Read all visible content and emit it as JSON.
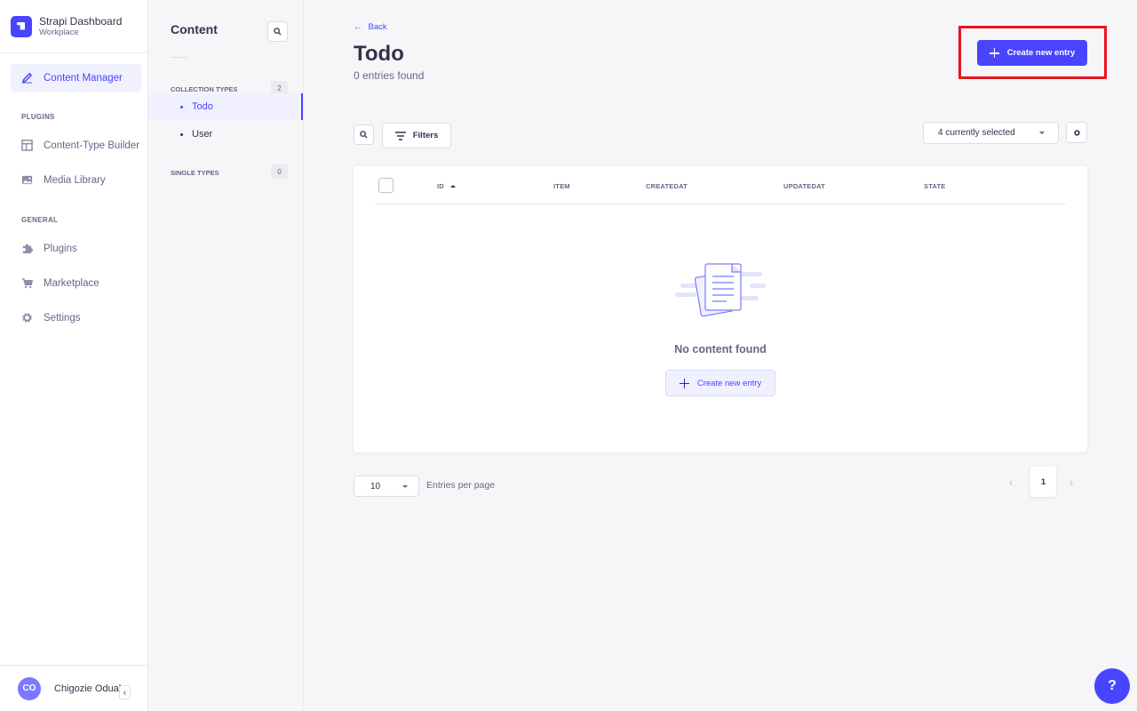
{
  "brand": {
    "title": "Strapi Dashboard",
    "subtitle": "Workplace"
  },
  "mainnav": {
    "content_manager": "Content Manager",
    "plugins_section": "PLUGINS",
    "content_type_builder": "Content-Type Builder",
    "media_library": "Media Library",
    "general_section": "GENERAL",
    "plugins": "Plugins",
    "marketplace": "Marketplace",
    "settings": "Settings"
  },
  "user": {
    "initials": "CO",
    "name": "Chigozie Oduah"
  },
  "subnav": {
    "title": "Content",
    "collection_types_label": "COLLECTION TYPES",
    "collection_types_count": "2",
    "collection_items": [
      "Todo",
      "User"
    ],
    "single_types_label": "SINGLE TYPES",
    "single_types_count": "0"
  },
  "header": {
    "back": "Back",
    "title": "Todo",
    "subtitle": "0 entries found",
    "create_button": "Create new entry"
  },
  "toolbar": {
    "filters": "Filters",
    "columns_select": "4 currently selected"
  },
  "table": {
    "columns": [
      "ID",
      "ITEM",
      "CREATEDAT",
      "UPDATEDAT",
      "STATE"
    ],
    "empty_text": "No content found",
    "empty_create": "Create new entry"
  },
  "pagination": {
    "page_size": "10",
    "per_page_label": "Entries per page",
    "current_page": "1",
    "prev": "‹",
    "next": "›"
  },
  "help": "?",
  "colors": {
    "primary": "#4945ff",
    "highlight": "#e8161c"
  }
}
